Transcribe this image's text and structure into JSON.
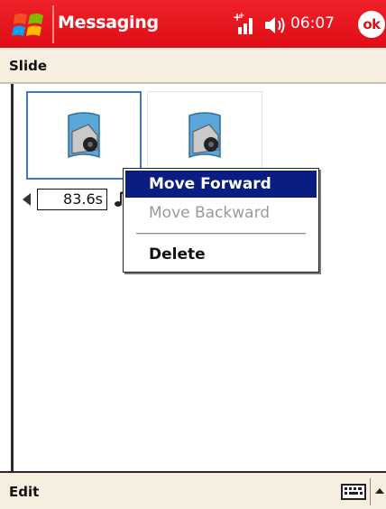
{
  "titlebar": {
    "app_title": "Messaging",
    "clock": "06:07",
    "ok_label": "ok",
    "icons": [
      "windows-start-icon",
      "signal-icon",
      "volume-icon"
    ]
  },
  "header": {
    "label": "Slide"
  },
  "slides": [
    {
      "icon": "picture-icon",
      "selected": true
    },
    {
      "icon": "picture-icon",
      "selected": false
    }
  ],
  "duration": {
    "value": "83.6s"
  },
  "context_menu": {
    "items": [
      {
        "label": "Move Forward",
        "state": "highlighted"
      },
      {
        "label": "Move Backward",
        "state": "disabled"
      },
      {
        "label": "Delete",
        "state": "enabled"
      }
    ]
  },
  "bottombar": {
    "left_label": "Edit",
    "icons": [
      "keyboard-icon",
      "sip-arrow-icon"
    ]
  },
  "colors": {
    "titlebar": "#e8141e",
    "menu_highlight": "#0a1d82",
    "selection_border": "#3a78c9",
    "bar_background": "#f6efdf"
  }
}
